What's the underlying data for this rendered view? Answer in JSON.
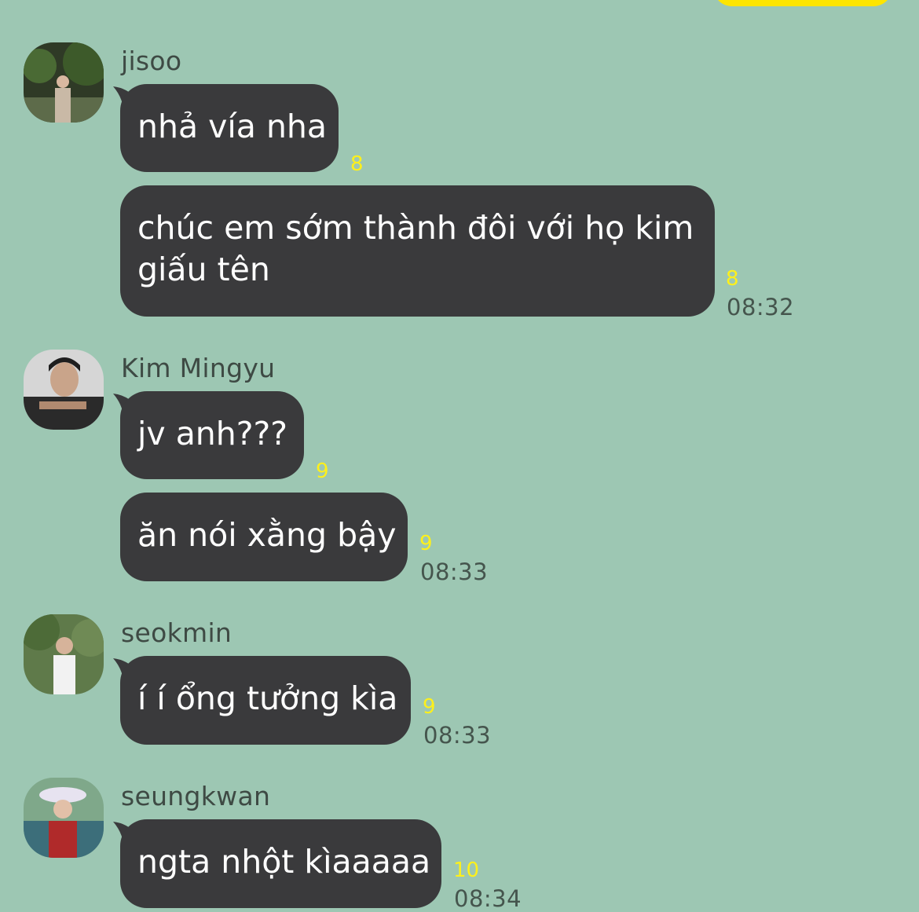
{
  "colors": {
    "background": "#9dc7b3",
    "bubble": "#3a3a3c",
    "my_bubble": "#fee500",
    "unread": "#fef01b",
    "time": "#45554d"
  },
  "messages": [
    {
      "sender": "jisoo",
      "bubbles": [
        {
          "text": "nhả vía nha",
          "unread": "8"
        },
        {
          "text": "chúc em sớm thành đôi với họ kim giấu tên",
          "unread": "8",
          "time": "08:32"
        }
      ]
    },
    {
      "sender": "Kim Mingyu",
      "bubbles": [
        {
          "text": "jv anh???",
          "unread": "9"
        },
        {
          "text": "ăn nói xằng bậy",
          "unread": "9",
          "time": "08:33"
        }
      ]
    },
    {
      "sender": "seokmin",
      "bubbles": [
        {
          "text": "í í ổng tưởng kìa",
          "unread": "9",
          "time": "08:33"
        }
      ]
    },
    {
      "sender": "seungkwan",
      "bubbles": [
        {
          "text": "ngta nhột kìaaaaa",
          "unread": "10",
          "time": "08:34"
        }
      ]
    }
  ]
}
